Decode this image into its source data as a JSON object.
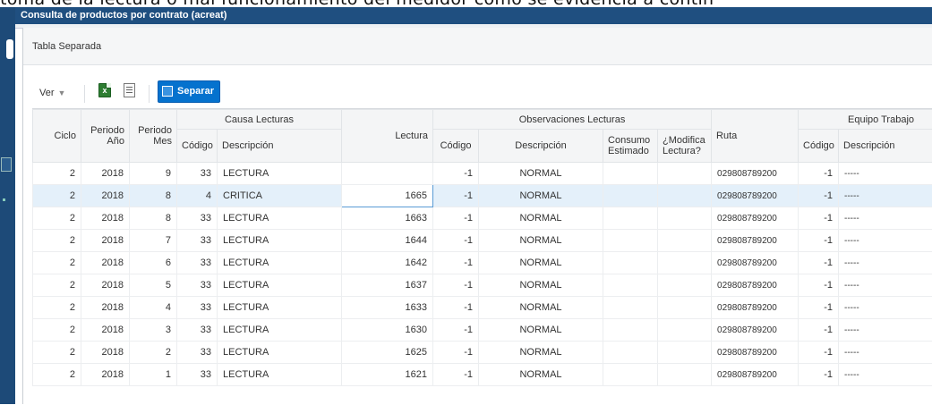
{
  "document_text": "toma de la lectura o mal funcionamiento del medidor como se evidencia a contin",
  "window": {
    "title": "Consulta de productos por contrato (acreat)"
  },
  "panel": {
    "title": "Tabla Separada"
  },
  "toolbar": {
    "view_label": "Ver",
    "export_icon": "excel-export-icon",
    "filter_icon": "filter-icon",
    "separar_label": "Separar"
  },
  "table": {
    "group_headers": {
      "causa": "Causa Lecturas",
      "observaciones": "Observaciones Lecturas",
      "equipo": "Equipo Trabajo"
    },
    "columns": {
      "ciclo": "Ciclo",
      "periodo_anio": "Periodo Año",
      "periodo_mes": "Periodo Mes",
      "causa_codigo": "Código",
      "causa_descripcion": "Descripción",
      "lectura": "Lectura",
      "obs_codigo": "Código",
      "obs_descripcion": "Descripción",
      "consumo_estimado": "Consumo Estimado",
      "modifica_lectura": "¿Modifica Lectura?",
      "ruta": "Ruta",
      "equipo_codigo": "Código",
      "equipo_descripcion": "Descripción"
    },
    "rows": [
      {
        "ciclo": "2",
        "anio": "2018",
        "mes": "9",
        "causa_cod": "33",
        "causa_desc": "LECTURA",
        "lectura": "",
        "obs_cod": "-1",
        "obs_desc": "NORMAL",
        "consumo": "",
        "modifica": "",
        "ruta": "029808789200",
        "eq_cod": "-1",
        "eq_desc": "-----"
      },
      {
        "ciclo": "2",
        "anio": "2018",
        "mes": "8",
        "causa_cod": "4",
        "causa_desc": "CRITICA",
        "lectura": "1665",
        "obs_cod": "-1",
        "obs_desc": "NORMAL",
        "consumo": "",
        "modifica": "",
        "ruta": "029808789200",
        "eq_cod": "-1",
        "eq_desc": "-----"
      },
      {
        "ciclo": "2",
        "anio": "2018",
        "mes": "8",
        "causa_cod": "33",
        "causa_desc": "LECTURA",
        "lectura": "1663",
        "obs_cod": "-1",
        "obs_desc": "NORMAL",
        "consumo": "",
        "modifica": "",
        "ruta": "029808789200",
        "eq_cod": "-1",
        "eq_desc": "-----"
      },
      {
        "ciclo": "2",
        "anio": "2018",
        "mes": "7",
        "causa_cod": "33",
        "causa_desc": "LECTURA",
        "lectura": "1644",
        "obs_cod": "-1",
        "obs_desc": "NORMAL",
        "consumo": "",
        "modifica": "",
        "ruta": "029808789200",
        "eq_cod": "-1",
        "eq_desc": "-----"
      },
      {
        "ciclo": "2",
        "anio": "2018",
        "mes": "6",
        "causa_cod": "33",
        "causa_desc": "LECTURA",
        "lectura": "1642",
        "obs_cod": "-1",
        "obs_desc": "NORMAL",
        "consumo": "",
        "modifica": "",
        "ruta": "029808789200",
        "eq_cod": "-1",
        "eq_desc": "-----"
      },
      {
        "ciclo": "2",
        "anio": "2018",
        "mes": "5",
        "causa_cod": "33",
        "causa_desc": "LECTURA",
        "lectura": "1637",
        "obs_cod": "-1",
        "obs_desc": "NORMAL",
        "consumo": "",
        "modifica": "",
        "ruta": "029808789200",
        "eq_cod": "-1",
        "eq_desc": "-----"
      },
      {
        "ciclo": "2",
        "anio": "2018",
        "mes": "4",
        "causa_cod": "33",
        "causa_desc": "LECTURA",
        "lectura": "1633",
        "obs_cod": "-1",
        "obs_desc": "NORMAL",
        "consumo": "",
        "modifica": "",
        "ruta": "029808789200",
        "eq_cod": "-1",
        "eq_desc": "-----"
      },
      {
        "ciclo": "2",
        "anio": "2018",
        "mes": "3",
        "causa_cod": "33",
        "causa_desc": "LECTURA",
        "lectura": "1630",
        "obs_cod": "-1",
        "obs_desc": "NORMAL",
        "consumo": "",
        "modifica": "",
        "ruta": "029808789200",
        "eq_cod": "-1",
        "eq_desc": "-----"
      },
      {
        "ciclo": "2",
        "anio": "2018",
        "mes": "2",
        "causa_cod": "33",
        "causa_desc": "LECTURA",
        "lectura": "1625",
        "obs_cod": "-1",
        "obs_desc": "NORMAL",
        "consumo": "",
        "modifica": "",
        "ruta": "029808789200",
        "eq_cod": "-1",
        "eq_desc": "-----"
      },
      {
        "ciclo": "2",
        "anio": "2018",
        "mes": "1",
        "causa_cod": "33",
        "causa_desc": "LECTURA",
        "lectura": "1621",
        "obs_cod": "-1",
        "obs_desc": "NORMAL",
        "consumo": "",
        "modifica": "",
        "ruta": "029808789200",
        "eq_cod": "-1",
        "eq_desc": "-----"
      }
    ],
    "selected_row": 1
  },
  "colors": {
    "title_bar": "#1f4f80",
    "accent_button": "#0572ce",
    "selected_row": "#e4f0fa",
    "header_bg": "#f4f5f6"
  }
}
